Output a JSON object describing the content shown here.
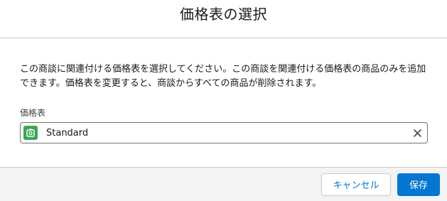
{
  "modal": {
    "title": "価格表の選択"
  },
  "body": {
    "description": "この商談に関連付ける価格表を選択してください。この商談を関連付ける価格表の商品のみを追加できます。価格表を変更すると、商談からすべての商品が削除されます。",
    "field_label": "価格表",
    "lookup_value": "Standard",
    "lookup_icon": "pricebook-icon",
    "lookup_icon_color": "#3ba755",
    "clear_icon": "close-icon"
  },
  "footer": {
    "cancel_label": "キャンセル",
    "save_label": "保存",
    "brand_color": "#0176d3"
  }
}
